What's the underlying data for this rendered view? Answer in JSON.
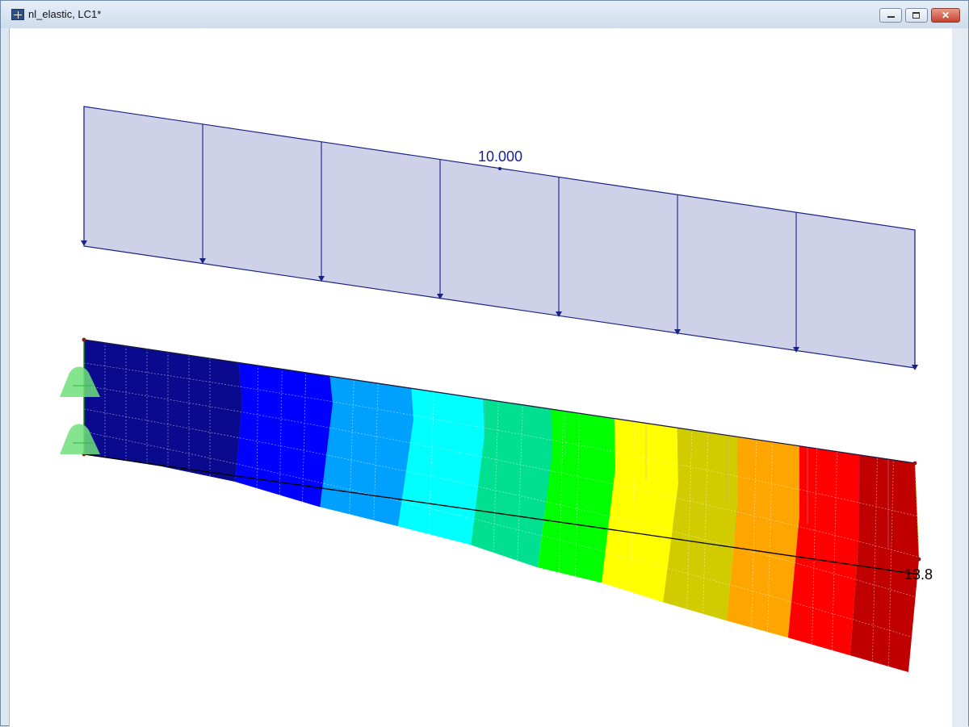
{
  "window": {
    "title": "nl_elastic, LC1*",
    "app_icon": "rfem-icon",
    "controls": {
      "minimize": "minimize-icon",
      "maximize": "maximize-icon",
      "close": "close-icon"
    }
  },
  "model": {
    "load_value": "10.000",
    "max_deformation_label": "13.8",
    "load_fill_color": "#cfd1e8",
    "load_line_color": "#1a2381",
    "undeformed_fill_color": "#7f7fff",
    "support_color": "#6fe07a",
    "contour_colors": [
      "#0a0a8f",
      "#0000ff",
      "#00a0ff",
      "#00ffff",
      "#00e090",
      "#00ff00",
      "#ffff00",
      "#d0cc00",
      "#ffa500",
      "#ff0000",
      "#c00000"
    ]
  }
}
